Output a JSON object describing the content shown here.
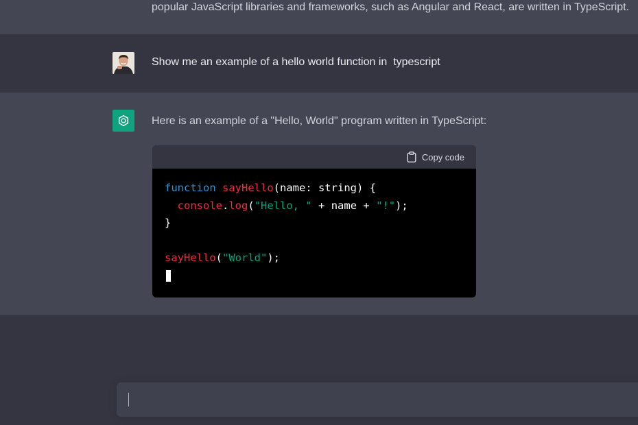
{
  "previous_message": {
    "text": "popular JavaScript libraries and frameworks, such as Angular and React, are written in TypeScript."
  },
  "user_message": {
    "text": "Show me an example of a hello world function in  typescript"
  },
  "assistant_message": {
    "intro": "Here is an example of a \"Hello, World\" program written in TypeScript:",
    "code_block": {
      "copy_label": "Copy code",
      "code": "function sayHello(name: string) {\n  console.log(\"Hello, \" + name + \"!\");\n}\n\nsayHello(\"World\");"
    }
  },
  "input": {
    "value": "",
    "placeholder": ""
  },
  "colors": {
    "background": "#343541",
    "assistant_row": "#444654",
    "brand_green": "#10a37f",
    "code_keyword": "#2e95d3",
    "code_function": "#f22c3d",
    "code_string": "#00a67d"
  }
}
